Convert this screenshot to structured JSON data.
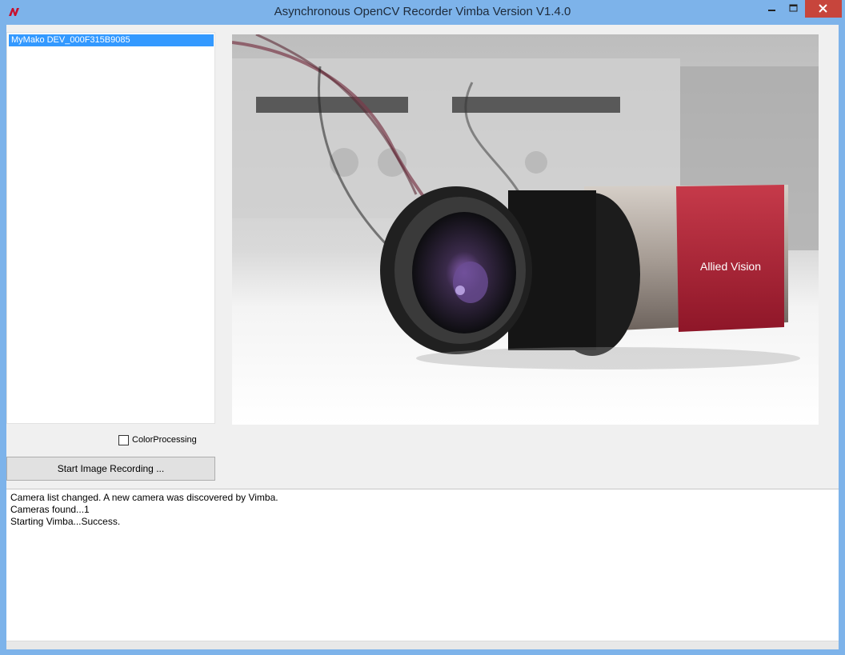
{
  "window": {
    "title": "Asynchronous OpenCV Recorder Vimba Version V1.4.0",
    "controls": [
      "minimize-icon",
      "maximize-icon",
      "close-icon"
    ],
    "accent_color": "#7db3ea",
    "close_color": "#c7453c"
  },
  "camera_list": {
    "items": [
      {
        "label": "MyMako DEV_000F315B9085",
        "selected": true
      }
    ]
  },
  "preview": {
    "brand_text": "Allied Vision"
  },
  "options": {
    "color_processing_label": "ColorProcessing",
    "color_processing_checked": false
  },
  "actions": {
    "record_label": "Start Image Recording ..."
  },
  "log": {
    "lines": [
      "Camera list changed. A new camera was discovered by Vimba.",
      "Cameras found...1",
      "Starting Vimba...Success."
    ]
  }
}
